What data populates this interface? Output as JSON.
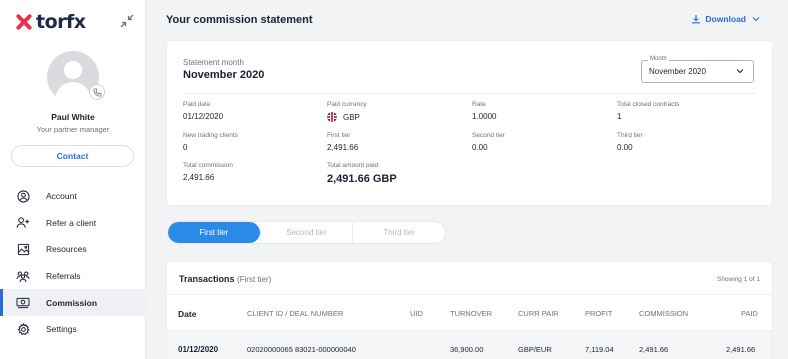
{
  "brand": {
    "name": "torfx",
    "accent": "#e8334a",
    "primary": "#2b6cd4"
  },
  "profile": {
    "name": "Paul White",
    "role": "Your partner manager",
    "contact_label": "Contact"
  },
  "nav": [
    {
      "label": "Account",
      "icon": "user-icon"
    },
    {
      "label": "Refer a client",
      "icon": "add-user-icon"
    },
    {
      "label": "Resources",
      "icon": "image-icon"
    },
    {
      "label": "Referrals",
      "icon": "users-icon"
    },
    {
      "label": "Commission",
      "icon": "commission-icon",
      "active": true
    },
    {
      "label": "Settings",
      "icon": "gear-icon"
    }
  ],
  "header": {
    "title": "Your commission statement",
    "download_label": "Download"
  },
  "statement": {
    "month_label": "Statement month",
    "month_value": "November 2020",
    "select_legend": "Month",
    "select_value": "November 2020",
    "fields": {
      "paid_date": {
        "label": "Paid date",
        "value": "01/12/2020"
      },
      "paid_currency": {
        "label": "Paid currency",
        "value": "GBP"
      },
      "rate": {
        "label": "Rate",
        "value": "1.0000"
      },
      "closed": {
        "label": "Total closed contracts",
        "value": "1"
      },
      "new_clients": {
        "label": "New trading clients",
        "value": "0"
      },
      "first_tier": {
        "label": "First tier",
        "value": "2,491.66"
      },
      "second_tier": {
        "label": "Second tier",
        "value": "0.00"
      },
      "third_tier": {
        "label": "Third tier",
        "value": "0.00"
      },
      "total_commission": {
        "label": "Total commission",
        "value": "2,491.66"
      },
      "total_paid": {
        "label": "Total amount paid",
        "value": "2,491.66 GBP"
      }
    }
  },
  "tabs": [
    "First tier",
    "Second tier",
    "Third tier"
  ],
  "transactions": {
    "title": "Transactions",
    "subtitle": "(First tier)",
    "count": "Showing 1 of 1",
    "columns": [
      "Date",
      "CLIENT ID / DEAL NUMBER",
      "UID",
      "TURNOVER",
      "CURR PAIR",
      "PROFIT",
      "COMMISSION",
      "PAID"
    ],
    "rows": [
      [
        "01/12/2020",
        "02020000065 83021-000000040",
        "",
        "36,900.00",
        "GBP/EUR",
        "7,119.04",
        "2,491.66",
        "2,491.66"
      ]
    ]
  }
}
